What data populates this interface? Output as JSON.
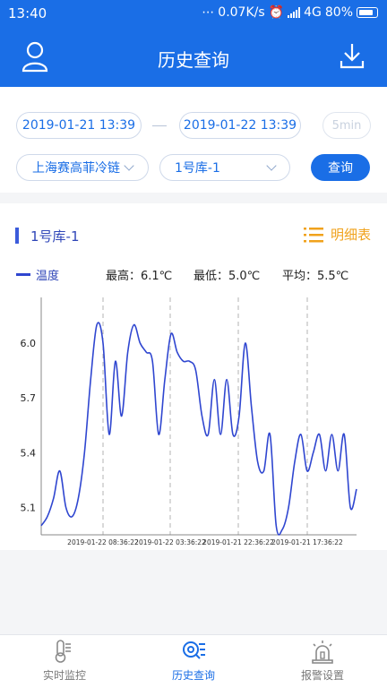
{
  "status": {
    "time": "13:40",
    "speed": "0.07K/s",
    "network": "4G",
    "battery": "80%"
  },
  "header": {
    "title": "历史查询",
    "user_icon": "user-icon",
    "download_icon": "download-icon"
  },
  "filter": {
    "start_time": "2019-01-21 13:39",
    "end_time": "2019-01-22 13:39",
    "interval": "5min",
    "company": "上海赛高菲冷链",
    "store": "1号库-1",
    "query_label": "查询"
  },
  "panel": {
    "store_name": "1号库-1",
    "detail_label": "明细表",
    "legend": "温度",
    "max_label": "最高：6.1℃",
    "min_label": "最低：5.0℃",
    "avg_label": "平均：5.5℃"
  },
  "chart_data": {
    "type": "line",
    "series": [
      {
        "name": "温度",
        "color": "#2f46d0"
      }
    ],
    "ylim": [
      4.95,
      6.25
    ],
    "yticks": [
      6.0,
      5.7,
      5.4,
      5.1
    ],
    "x_tick_labels": [
      "2019-01-22 08:36:22",
      "2019-01-22 03:36:22",
      "2019-01-21 22:36:22",
      "2019-01-21 17:36:22"
    ],
    "grid_vertical": "dashed",
    "values": [
      5.0,
      5.05,
      5.15,
      5.3,
      5.1,
      5.05,
      5.15,
      5.4,
      5.8,
      6.1,
      6.0,
      5.5,
      5.9,
      5.6,
      5.95,
      6.1,
      6.0,
      5.95,
      5.9,
      5.5,
      5.8,
      6.05,
      5.95,
      5.9,
      5.9,
      5.85,
      5.6,
      5.5,
      5.8,
      5.5,
      5.8,
      5.5,
      5.6,
      6.0,
      5.65,
      5.35,
      5.3,
      5.5,
      5.0,
      4.98,
      5.1,
      5.35,
      5.5,
      5.3,
      5.4,
      5.5,
      5.3,
      5.5,
      5.3,
      5.5,
      5.1,
      5.2
    ]
  },
  "tabs": [
    {
      "label": "实时监控",
      "icon": "thermometer-icon"
    },
    {
      "label": "历史查询",
      "icon": "search-list-icon"
    },
    {
      "label": "报警设置",
      "icon": "alarm-icon"
    }
  ],
  "colors": {
    "primary": "#1a6ee6",
    "accent": "#f0a21c",
    "line": "#2f46d0"
  }
}
